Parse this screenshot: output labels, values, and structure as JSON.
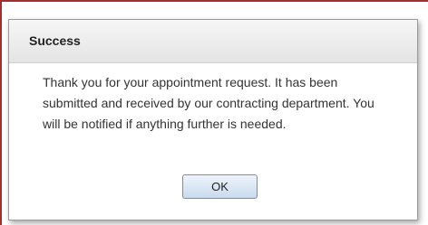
{
  "dialog": {
    "title": "Success",
    "message": "Thank you for your appointment request. It has been submitted and received by our contracting department. You will be notified if anything further is needed.",
    "ok_label": "OK"
  }
}
